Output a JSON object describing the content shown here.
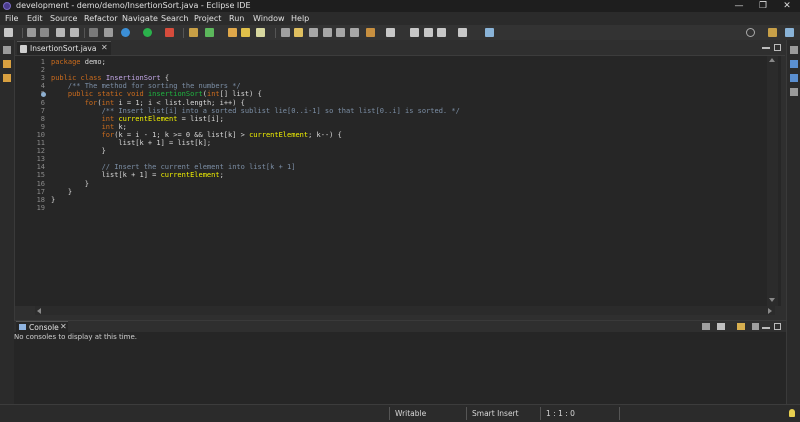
{
  "window": {
    "title": "development - demo/demo/InsertionSort.java - Eclipse IDE",
    "minimize_glyph": "—",
    "restore_glyph": "❐",
    "close_glyph": "✕"
  },
  "menu": [
    "File",
    "Edit",
    "Source",
    "Refactor",
    "Navigate",
    "Search",
    "Project",
    "Run",
    "Window",
    "Help"
  ],
  "editor": {
    "tab_label": "InsertionSort.java",
    "tab_close": "✕",
    "lines": [
      {
        "n": "1",
        "code": "package demo;"
      },
      {
        "n": "2",
        "code": ""
      },
      {
        "n": "3",
        "code": "public class InsertionSort {"
      },
      {
        "n": "4",
        "code": "    /** The method for sorting the numbers */"
      },
      {
        "n": "5",
        "code": "    public static void insertionSort(int[] list) {"
      },
      {
        "n": "6",
        "code": "        for(int i = 1; i < list.length; i++) {"
      },
      {
        "n": "7",
        "code": "            /** Insert list[i] into a sorted sublist lie[0..i-1] so that list[0..i] is sorted. */"
      },
      {
        "n": "8",
        "code": "            int currentElement = list[i];"
      },
      {
        "n": "9",
        "code": "            int k;"
      },
      {
        "n": "10",
        "code": "            for(k = i - 1; k >= 0 && list[k] > currentElement; k--) {"
      },
      {
        "n": "11",
        "code": "                list[k + 1] = list[k];"
      },
      {
        "n": "12",
        "code": "            }"
      },
      {
        "n": "13",
        "code": ""
      },
      {
        "n": "14",
        "code": "            // Insert the current element into list[k + 1]"
      },
      {
        "n": "15",
        "code": "            list[k + 1] = currentElement;"
      },
      {
        "n": "16",
        "code": "        }"
      },
      {
        "n": "17",
        "code": "    }"
      },
      {
        "n": "18",
        "code": "}"
      },
      {
        "n": "19",
        "code": ""
      }
    ]
  },
  "console": {
    "tab_label": "Console",
    "tab_close": "✕",
    "message": "No consoles to display at this time."
  },
  "status": {
    "writable": "Writable",
    "insert_mode": "Smart Insert",
    "position": "1 : 1 : 0"
  },
  "colors": {
    "keyword": "#cc6c1d",
    "comment": "#7c8fa6",
    "method": "#1eb540",
    "variable": "#f2f200",
    "background": "#262626"
  }
}
